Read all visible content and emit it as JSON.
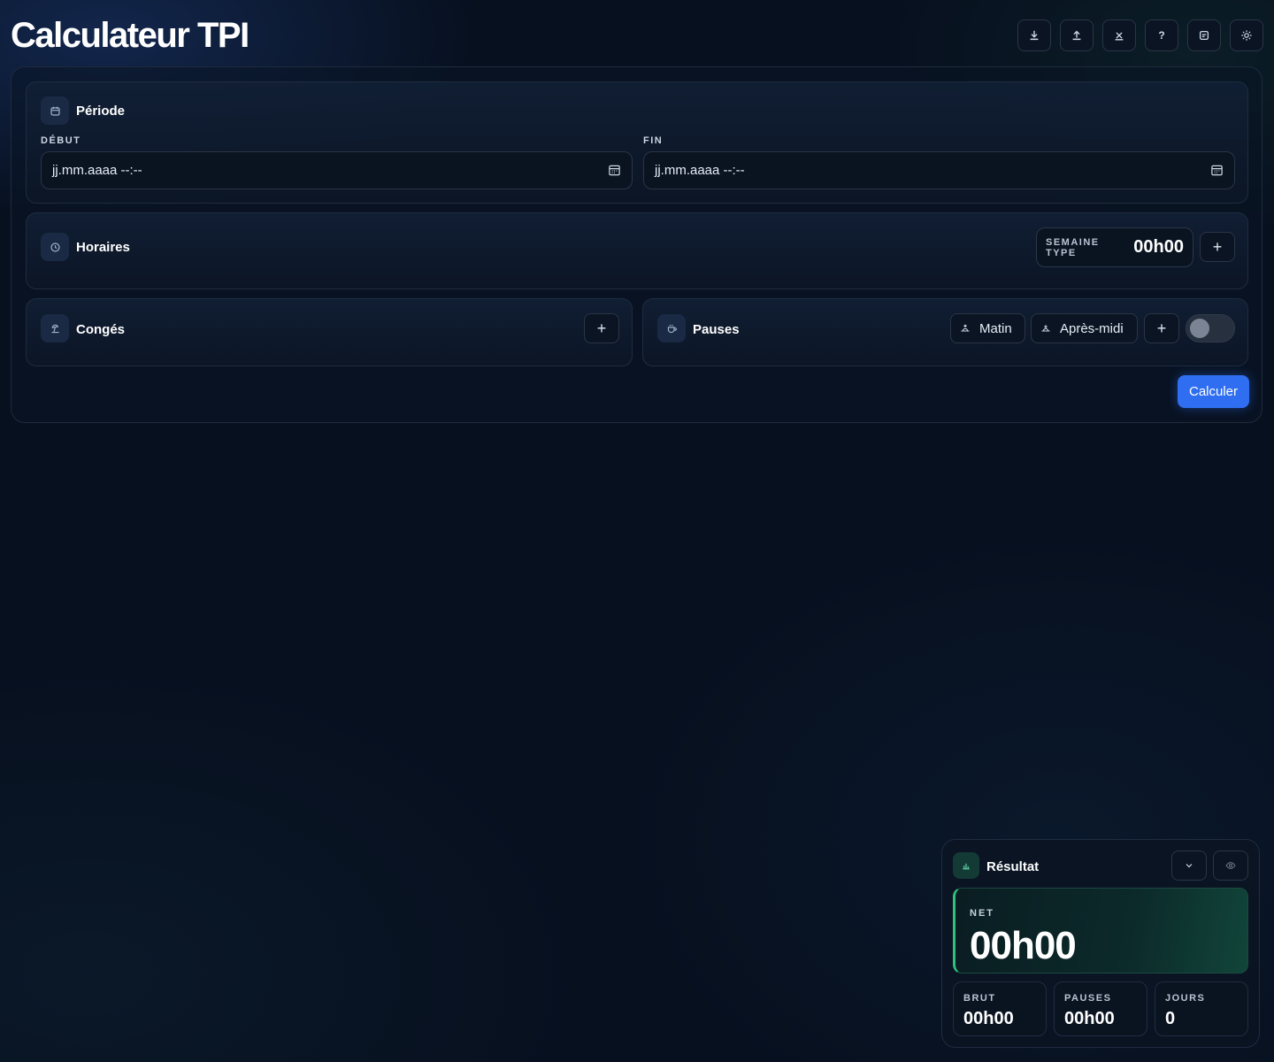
{
  "app": {
    "title": "Calculateur TPI"
  },
  "toolbar": [
    {
      "name": "download-icon",
      "label": ""
    },
    {
      "name": "upload-icon",
      "label": ""
    },
    {
      "name": "close-icon",
      "label": ""
    },
    {
      "name": "help-icon",
      "label": "?"
    },
    {
      "name": "notes-icon",
      "label": ""
    },
    {
      "name": "theme-icon",
      "label": ""
    }
  ],
  "periode": {
    "title": "Période",
    "debut_label": "DÉBUT",
    "debut_value": "jj.mm.aaaa --:--",
    "fin_label": "FIN",
    "fin_value": "jj.mm.aaaa --:--"
  },
  "horaires": {
    "title": "Horaires",
    "semaine_label": "SEMAINE TYPE",
    "semaine_value": "00h00",
    "add_label": "+"
  },
  "conges": {
    "title": "Congés",
    "add_label": "+"
  },
  "pauses": {
    "title": "Pauses",
    "matin_label": "Matin",
    "apres_midi_label": "Après-midi",
    "add_label": "+",
    "toggle_on": false
  },
  "actions": {
    "calculer_label": "Calculer"
  },
  "resultat": {
    "title": "Résultat",
    "net_label": "NET",
    "net_value": "00h00",
    "brut_label": "BRUT",
    "brut_value": "00h00",
    "pauses_label": "PAUSES",
    "pauses_value": "00h00",
    "jours_label": "JOURS",
    "jours_value": "0"
  },
  "colors": {
    "accent": "#2f6ef0",
    "success": "#2ec27e",
    "background": "#07101f"
  }
}
